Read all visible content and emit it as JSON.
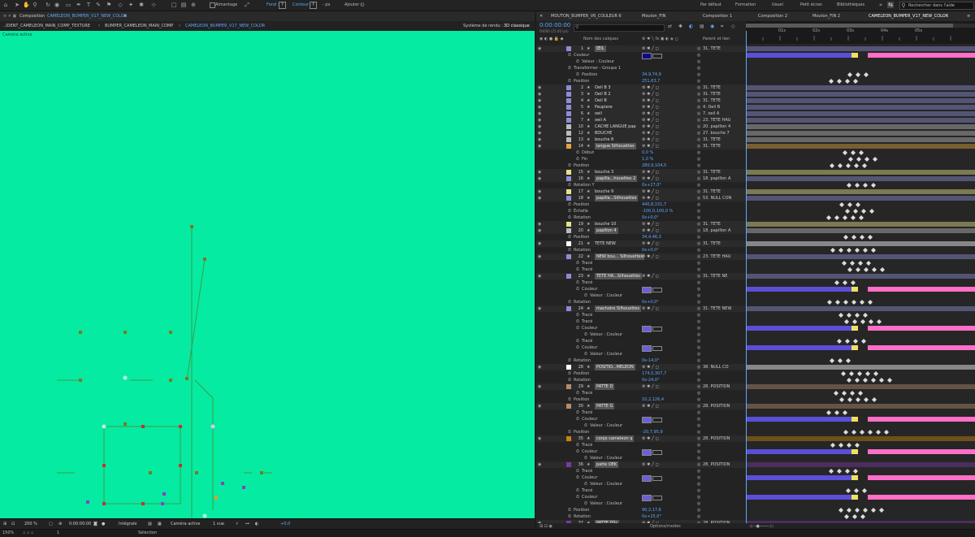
{
  "toolbar": {
    "snapping_label": "Aimantage",
    "fill_label": "Fond :",
    "stroke_label": "Contour :",
    "stroke_unit": "- px",
    "add_label": "Ajouter :",
    "workspaces": [
      "Par défaut",
      "Formation",
      "Usuel",
      "Petit écran",
      "Bibliothèques"
    ],
    "search_placeholder": "Rechercher dans l'aide"
  },
  "composition": {
    "tab_label": "Composition",
    "tab_name": "CAMELEON_BUMPER_V17_NEW_COLOR",
    "breadcrumbs": [
      "..IDENT_CAMELEON_MAIN_COMP_TEXTURE",
      "BUMPER_CAMELEON_MAIN_COMP",
      "CAMELEON_BUMPER_V17_NEW_COLOR"
    ],
    "renderer_label": "Système de rendu :",
    "renderer_value": "3D classique",
    "camera_overlay": "Caméra active",
    "bg_color": "#05eba1"
  },
  "viewer_bottom": {
    "zoom": "200 %",
    "timecode": "0:00:00:00",
    "resolution": "Intégrale",
    "camera": "Caméra active",
    "views": "1 vue",
    "exposure": "+0,0"
  },
  "timeline": {
    "tabs": [
      "MOUTON_BUMPER_V6_COULEUR 6",
      "Mouton_FIN",
      "Composition 1",
      "Composition 2",
      "Mouton_FIN 2",
      "CAMELEON_BUMPER_V17_NEW_COLOR"
    ],
    "timecode": "0:00:00:00",
    "timecode_sub": "00000 (25.00 ips)",
    "col_name": "Nom des calques",
    "col_parent": "Parent et lien",
    "ruler": [
      "01s",
      "02s",
      "03s",
      "04s",
      "05s"
    ],
    "toggle_modes": "Options/modes"
  },
  "layers": [
    {
      "type": "layer",
      "num": "1",
      "name": "ŒIL",
      "label": "#8d8dd6",
      "parent": "31. TETE",
      "boxed": true
    },
    {
      "type": "prop",
      "indent": 1,
      "name": "Couleur",
      "swatch": "#0a0a8a"
    },
    {
      "type": "prop",
      "indent": 2,
      "name": "Valeur : Couleur"
    },
    {
      "type": "prop",
      "indent": 1,
      "name": "Transformer - Groupe 1"
    },
    {
      "type": "prop",
      "indent": 2,
      "name": "Position",
      "value": "34,9,74,9"
    },
    {
      "type": "prop",
      "indent": 1,
      "name": "Position",
      "value": "251,63,7"
    },
    {
      "type": "layer",
      "num": "2",
      "name": "Oeil B 3",
      "label": "#8d8dd6",
      "parent": "31. TETE"
    },
    {
      "type": "layer",
      "num": "3",
      "name": "Oeil B 2",
      "label": "#8d8dd6",
      "parent": "31. TETE"
    },
    {
      "type": "layer",
      "num": "4",
      "name": "Oeil B",
      "label": "#8d8dd6",
      "parent": "31. TETE"
    },
    {
      "type": "layer",
      "num": "5",
      "name": "Paupiere",
      "label": "#8d8dd6",
      "parent": "4. Oeil B"
    },
    {
      "type": "layer",
      "num": "6",
      "name": "oeil",
      "label": "#8d8dd6",
      "parent": "7. oeil A"
    },
    {
      "type": "layer",
      "num": "7",
      "name": "oeil A",
      "label": "#8d8dd6",
      "parent": "23. TETE HAU"
    },
    {
      "type": "layer",
      "num": "10",
      "name": "CACHE LANGUE pap",
      "label": "#bbbbbb",
      "parent": "20. papillon 4"
    },
    {
      "type": "layer",
      "num": "12",
      "name": "BOUCHE",
      "label": "#bbbbbb",
      "parent": "27. bouche 7"
    },
    {
      "type": "layer",
      "num": "13",
      "name": "bouche 8",
      "label": "#bbbbbb",
      "parent": "31. TETE"
    },
    {
      "type": "layer",
      "num": "14",
      "name": "langue Silhouettes",
      "label": "#e1a63c",
      "parent": "31. TETE",
      "boxed": true
    },
    {
      "type": "prop",
      "indent": 2,
      "name": "Début",
      "value": "0,0 %"
    },
    {
      "type": "prop",
      "indent": 2,
      "name": "Fin",
      "value": "1,0 %"
    },
    {
      "type": "prop",
      "indent": 1,
      "name": "Position",
      "value": "280,9,104,5"
    },
    {
      "type": "layer",
      "num": "15",
      "name": "bouche 3",
      "label": "#e6e28a",
      "parent": "31. TETE"
    },
    {
      "type": "layer",
      "num": "16",
      "name": "papilla...houettes 2",
      "label": "#8d8dd6",
      "parent": "18. papillon A",
      "boxed": true
    },
    {
      "type": "prop",
      "indent": 1,
      "name": "Rotation Y",
      "value": "0x+27,0°"
    },
    {
      "type": "layer",
      "num": "17",
      "name": "bouche 9",
      "label": "#e6e28a",
      "parent": "31. TETE"
    },
    {
      "type": "layer",
      "num": "18",
      "name": "papilla...Silhouettes",
      "label": "#8d8dd6",
      "parent": "53. NULL CON",
      "boxed": true
    },
    {
      "type": "prop",
      "indent": 1,
      "name": "Position",
      "value": "440,8,151,7"
    },
    {
      "type": "prop",
      "indent": 1,
      "name": "Échelle",
      "value": "-100,0,100,0 %"
    },
    {
      "type": "prop",
      "indent": 1,
      "name": "Rotation",
      "value": "0x+0,0°"
    },
    {
      "type": "layer",
      "num": "19",
      "name": "bouche 10",
      "label": "#e6e28a",
      "parent": "31. TETE"
    },
    {
      "type": "layer",
      "num": "20",
      "name": "papillon 4",
      "label": "#bbbbbb",
      "parent": "18. papillon A",
      "boxed": true
    },
    {
      "type": "prop",
      "indent": 1,
      "name": "Position",
      "value": "34,4,46,3"
    },
    {
      "type": "layer",
      "num": "21",
      "name": "TETE NEW",
      "label": "#ffffff",
      "parent": "31. TETE"
    },
    {
      "type": "prop",
      "indent": 1,
      "name": "Rotation",
      "value": "0x+0,0°"
    },
    {
      "type": "layer",
      "num": "22",
      "name": "NEW bou... Silhouettes",
      "label": "#8d8dd6",
      "parent": "23. TETE HAU",
      "boxed": true
    },
    {
      "type": "prop",
      "indent": 2,
      "name": "Tracé"
    },
    {
      "type": "prop",
      "indent": 2,
      "name": "Tracé"
    },
    {
      "type": "layer",
      "num": "23",
      "name": "TETE HA...Silhouettes",
      "label": "#8d8dd6",
      "parent": "31. TETE NE",
      "boxed": true
    },
    {
      "type": "prop",
      "indent": 2,
      "name": "Tracé"
    },
    {
      "type": "prop",
      "indent": 2,
      "name": "Couleur",
      "swatch": "#6b5fd8"
    },
    {
      "type": "prop",
      "indent": 3,
      "name": "Valeur : Couleur"
    },
    {
      "type": "prop",
      "indent": 1,
      "name": "Rotation",
      "value": "0x+0,0°"
    },
    {
      "type": "layer",
      "num": "24",
      "name": "machoire Silhouettes",
      "label": "#8d8dd6",
      "parent": "31. TETE NEW",
      "boxed": true
    },
    {
      "type": "prop",
      "indent": 2,
      "name": "Tracé"
    },
    {
      "type": "prop",
      "indent": 2,
      "name": "Tracé"
    },
    {
      "type": "prop",
      "indent": 2,
      "name": "Couleur",
      "swatch": "#6b5fd8"
    },
    {
      "type": "prop",
      "indent": 3,
      "name": "Valeur : Couleur"
    },
    {
      "type": "prop",
      "indent": 2,
      "name": "Tracé"
    },
    {
      "type": "prop",
      "indent": 2,
      "name": "Couleur",
      "swatch": "#6b5fd8"
    },
    {
      "type": "prop",
      "indent": 3,
      "name": "Valeur : Couleur"
    },
    {
      "type": "prop",
      "indent": 1,
      "name": "Rotation",
      "value": "0x-14,0°"
    },
    {
      "type": "layer",
      "num": "28",
      "name": "POSITIO...MELEON",
      "label": "#ffffff",
      "parent": "38. NULL CO",
      "boxed": true
    },
    {
      "type": "prop",
      "indent": 1,
      "name": "Position",
      "value": "174,0,307,7"
    },
    {
      "type": "prop",
      "indent": 1,
      "name": "Rotation",
      "value": "0x-24,0°"
    },
    {
      "type": "layer",
      "num": "29",
      "name": "PATTE D",
      "label": "#b48d6e",
      "parent": "28. POSITION",
      "boxed": true
    },
    {
      "type": "prop",
      "indent": 2,
      "name": "Tracé"
    },
    {
      "type": "prop",
      "indent": 1,
      "name": "Position",
      "value": "10,2,126,4"
    },
    {
      "type": "layer",
      "num": "30",
      "name": "PATTE G",
      "label": "#b48d6e",
      "parent": "28. POSITION",
      "boxed": true
    },
    {
      "type": "prop",
      "indent": 2,
      "name": "Tracé"
    },
    {
      "type": "prop",
      "indent": 2,
      "name": "Couleur",
      "swatch": "#6b5fd8"
    },
    {
      "type": "prop",
      "indent": 3,
      "name": "Valeur : Couleur"
    },
    {
      "type": "prop",
      "indent": 1,
      "name": "Position",
      "value": "-20,7,95,9"
    },
    {
      "type": "layer",
      "num": "35",
      "name": "corps cameleon q",
      "label": "#c8860f",
      "parent": "28. POSITION",
      "boxed": true
    },
    {
      "type": "prop",
      "indent": 2,
      "name": "Tracé"
    },
    {
      "type": "prop",
      "indent": 2,
      "name": "Couleur",
      "swatch": "#6b5fd8"
    },
    {
      "type": "prop",
      "indent": 3,
      "name": "Valeur : Couleur"
    },
    {
      "type": "layer",
      "num": "36",
      "name": "patte OEK",
      "label": "#7a3aa6",
      "parent": "28. POSITION",
      "boxed": true
    },
    {
      "type": "prop",
      "indent": 2,
      "name": "Tracé"
    },
    {
      "type": "prop",
      "indent": 2,
      "name": "Couleur",
      "swatch": "#6b5fd8"
    },
    {
      "type": "prop",
      "indent": 3,
      "name": "Valeur : Couleur"
    },
    {
      "type": "prop",
      "indent": 2,
      "name": "Tracé"
    },
    {
      "type": "prop",
      "indent": 2,
      "name": "Couleur",
      "swatch": "#6b5fd8"
    },
    {
      "type": "prop",
      "indent": 3,
      "name": "Valeur : Couleur"
    },
    {
      "type": "prop",
      "indent": 1,
      "name": "Position",
      "value": "90,2,17,6"
    },
    {
      "type": "prop",
      "indent": 1,
      "name": "Rotation",
      "value": "0x+25,0°"
    },
    {
      "type": "layer",
      "num": "37",
      "name": "PATTE DSr",
      "label": "#7a3aa6",
      "parent": "28. POSITION",
      "boxed": true
    },
    {
      "type": "prop",
      "indent": 2,
      "name": "Tracé"
    },
    {
      "type": "prop",
      "indent": 1,
      "name": "Position",
      "value": "-14,0,19,6"
    }
  ],
  "status": {
    "zoom": "150%",
    "frame": "1",
    "tool": "Sélection"
  }
}
